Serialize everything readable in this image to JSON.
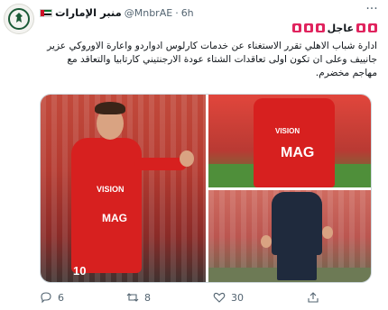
{
  "tweet": {
    "author": {
      "name": "منبر الإمارات",
      "handle": "@MnbrAE",
      "separator": "·",
      "time": "6h"
    },
    "breaking_label": "عاجل",
    "text": "ادارة شباب الاهلي تقرر الاستغناء عن خدمات كارلوس ادواردو واعارة الاوروكي عزير جانييف وعلى ان تكون اولى تعاقدات الشتاء عودة الارجنتيني كارتابيا والتعاقد مع مهاجم مخضرم.",
    "media": {
      "jersey_sponsor": "MAG",
      "jersey_partner": "VISION",
      "shirt_number": "10"
    },
    "actions": {
      "replies": "6",
      "retweets": "8",
      "likes": "30"
    }
  },
  "colors": {
    "accent": "#e0245e",
    "muted": "#536471",
    "jersey": "#d7201f",
    "brand_green": "#1b5a37"
  },
  "icons": [
    "more-icon",
    "siren-icon",
    "reply-icon",
    "retweet-icon",
    "like-icon",
    "share-icon"
  ]
}
